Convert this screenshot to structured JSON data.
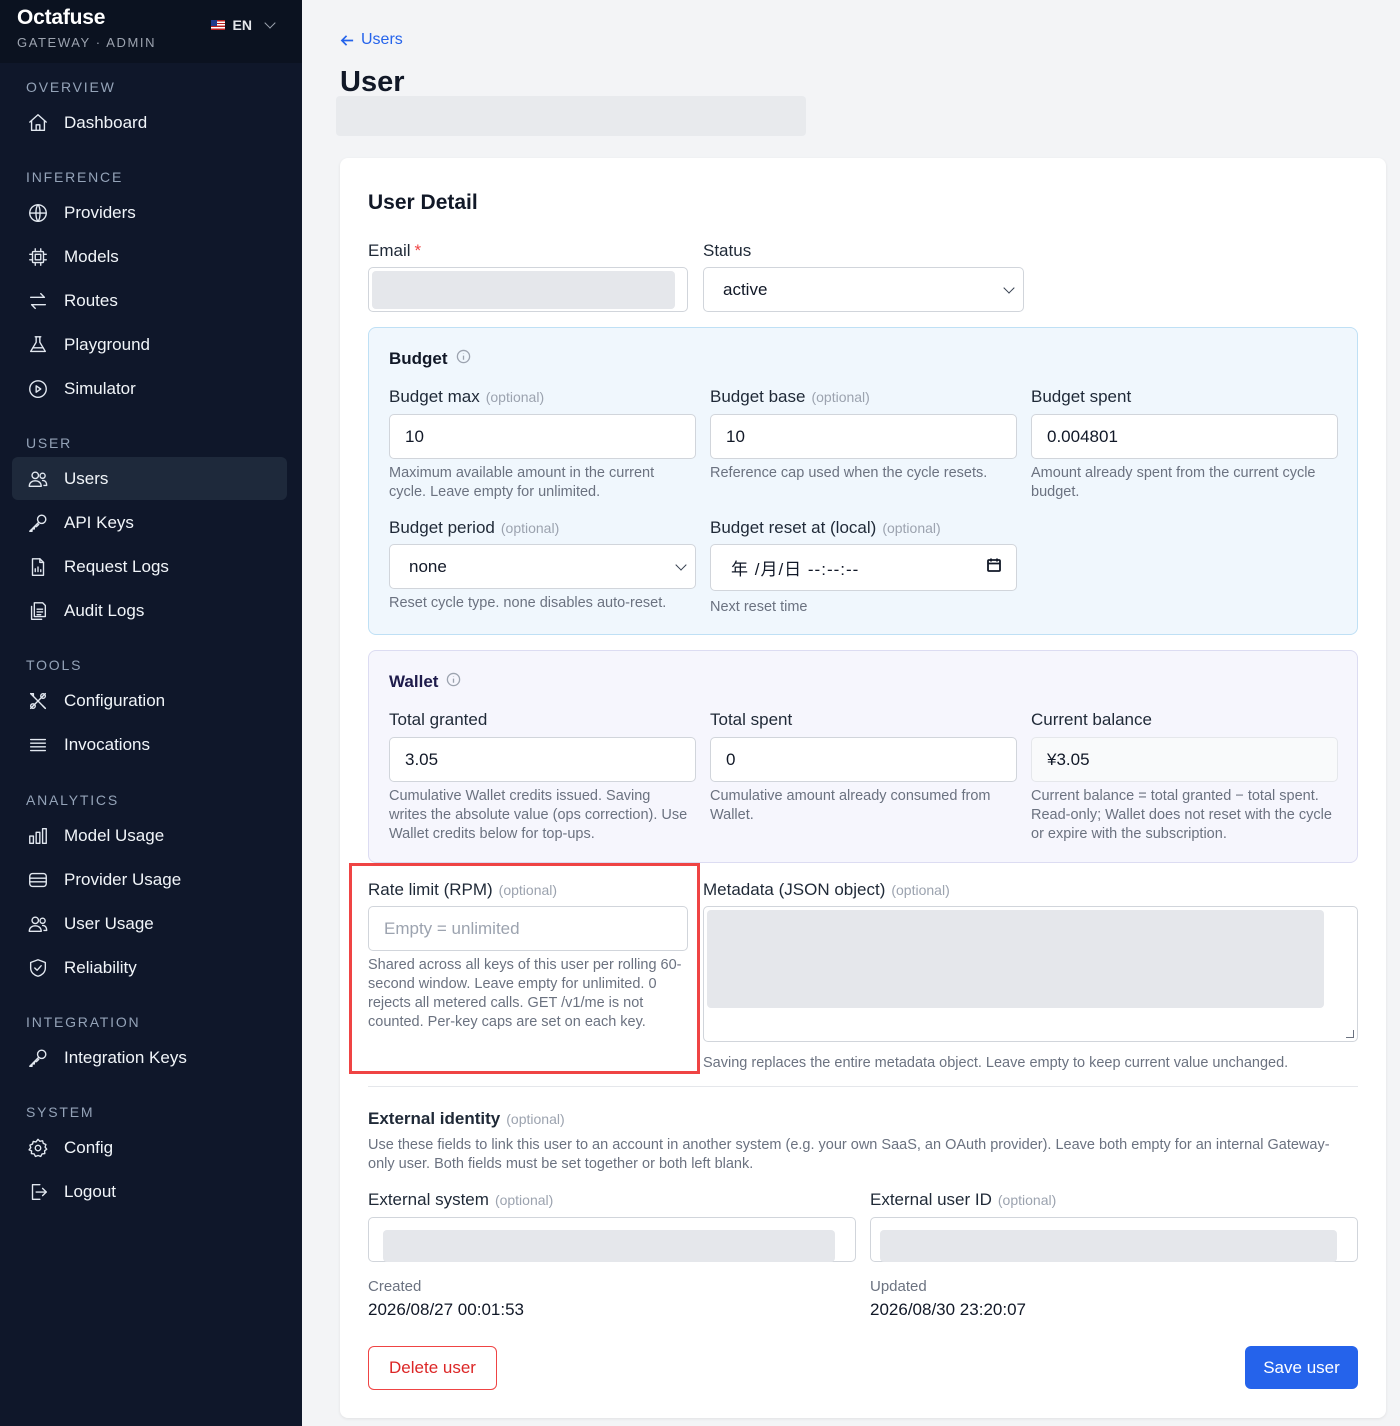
{
  "brand": {
    "title": "Octafuse",
    "subtitle": "GATEWAY · ADMIN",
    "language": "EN"
  },
  "sidebar": {
    "sections": [
      {
        "label": "OVERVIEW",
        "items": [
          {
            "label": "Dashboard",
            "icon": "home-icon"
          }
        ]
      },
      {
        "label": "INFERENCE",
        "items": [
          {
            "label": "Providers",
            "icon": "globe-icon"
          },
          {
            "label": "Models",
            "icon": "chip-icon"
          },
          {
            "label": "Routes",
            "icon": "arrows-icon"
          },
          {
            "label": "Playground",
            "icon": "flask-icon"
          },
          {
            "label": "Simulator",
            "icon": "play-circle-icon"
          }
        ]
      },
      {
        "label": "USER",
        "items": [
          {
            "label": "Users",
            "icon": "users-icon",
            "active": true
          },
          {
            "label": "API Keys",
            "icon": "key-icon"
          },
          {
            "label": "Request Logs",
            "icon": "document-icon"
          },
          {
            "label": "Audit Logs",
            "icon": "documents-icon"
          }
        ]
      },
      {
        "label": "TOOLS",
        "items": [
          {
            "label": "Configuration",
            "icon": "tools-icon"
          },
          {
            "label": "Invocations",
            "icon": "list-icon"
          }
        ]
      },
      {
        "label": "ANALYTICS",
        "items": [
          {
            "label": "Model Usage",
            "icon": "bar-chart-icon"
          },
          {
            "label": "Provider Usage",
            "icon": "server-icon"
          },
          {
            "label": "User Usage",
            "icon": "users-icon"
          },
          {
            "label": "Reliability",
            "icon": "shield-icon"
          }
        ]
      },
      {
        "label": "INTEGRATION",
        "items": [
          {
            "label": "Integration Keys",
            "icon": "key-icon"
          }
        ]
      },
      {
        "label": "SYSTEM",
        "items": [
          {
            "label": "Config",
            "icon": "gear-icon"
          },
          {
            "label": "Logout",
            "icon": "logout-icon"
          }
        ]
      }
    ]
  },
  "header": {
    "back_label": "Users",
    "title": "User"
  },
  "detail": {
    "title": "User Detail",
    "email_label": "Email",
    "required_mark": "*",
    "status_label": "Status",
    "status_value": "active",
    "optional": "(optional)",
    "budget": {
      "title": "Budget",
      "max_label": "Budget max",
      "max_value": "10",
      "max_help": "Maximum available amount in the current cycle. Leave empty for unlimited.",
      "base_label": "Budget base",
      "base_value": "10",
      "base_help": "Reference cap used when the cycle resets.",
      "spent_label": "Budget spent",
      "spent_value": "0.004801",
      "spent_help": "Amount already spent from the current cycle budget.",
      "period_label": "Budget period",
      "period_value": "none",
      "period_help": "Reset cycle type. none disables auto-reset.",
      "reset_label": "Budget reset at (local)",
      "reset_value": "年 /月/日 --:--:--",
      "reset_help": "Next reset time"
    },
    "wallet": {
      "title": "Wallet",
      "granted_label": "Total granted",
      "granted_value": "3.05",
      "granted_help": "Cumulative Wallet credits issued. Saving writes the absolute value (ops correction). Use Wallet credits below for top-ups.",
      "spent_label": "Total spent",
      "spent_value": "0",
      "spent_help": "Cumulative amount already consumed from Wallet.",
      "balance_label": "Current balance",
      "balance_value": "¥3.05",
      "balance_help": "Current balance = total granted − total spent. Read-only; Wallet does not reset with the cycle or expire with the subscription."
    },
    "rate_limit": {
      "label": "Rate limit (RPM)",
      "placeholder": "Empty = unlimited",
      "help": "Shared across all keys of this user per rolling 60-second window. Leave empty for unlimited. 0 rejects all metered calls. GET /v1/me is not counted. Per-key caps are set on each key."
    },
    "metadata": {
      "label": "Metadata (JSON object)",
      "help": "Saving replaces the entire metadata object. Leave empty to keep current value unchanged."
    },
    "external": {
      "title": "External identity",
      "description": "Use these fields to link this user to an account in another system (e.g. your own SaaS, an OAuth provider). Leave both empty for an internal Gateway-only user. Both fields must be set together or both left blank.",
      "system_label": "External system",
      "user_id_label": "External user ID"
    },
    "created_label": "Created",
    "created_value": "2026/08/27 00:01:53",
    "updated_label": "Updated",
    "updated_value": "2026/08/30 23:20:07",
    "delete_label": "Delete user",
    "save_label": "Save user"
  },
  "colors": {
    "sidebar_bg": "#0f172a",
    "accent": "#2563eb",
    "danger": "#ef4444"
  }
}
